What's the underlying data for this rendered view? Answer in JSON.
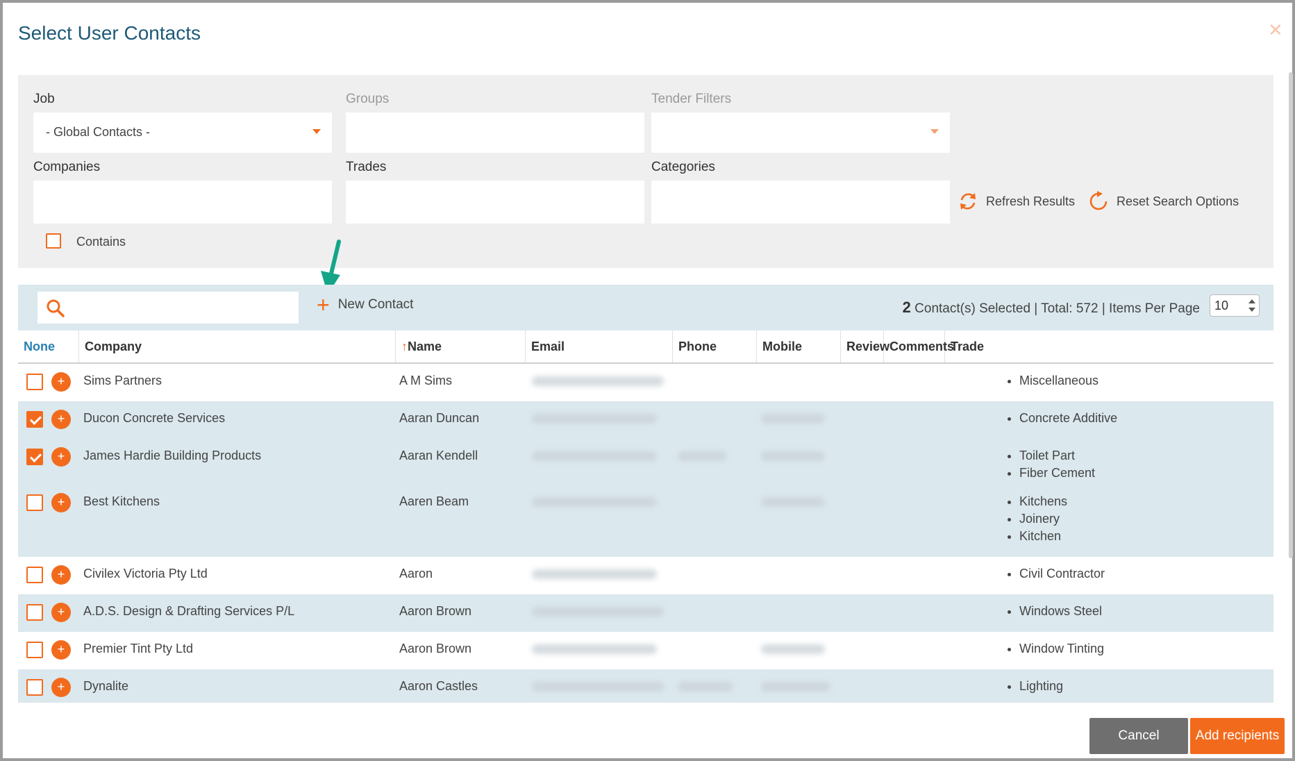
{
  "dialog": {
    "title": "Select User Contacts",
    "close_icon": "close-icon"
  },
  "filters": {
    "job_label": "Job",
    "job_value": "- Global Contacts -",
    "groups_label": "Groups",
    "tender_label": "Tender Filters",
    "companies_label": "Companies",
    "trades_label": "Trades",
    "categories_label": "Categories",
    "refresh_label": "Refresh Results",
    "reset_label": "Reset Search Options",
    "contains_label": "Contains",
    "contains_checked": false
  },
  "toolbar": {
    "search_placeholder": "",
    "new_contact_label": "New Contact",
    "selected_count": "2",
    "selected_text": "Contact(s) Selected | Total: 572 | Items Per Page",
    "items_per_page": "10"
  },
  "table": {
    "headers": {
      "none": "None",
      "company": "Company",
      "name_arrow": "↑",
      "name": "Name",
      "email": "Email",
      "phone": "Phone",
      "mobile": "Mobile",
      "review": "Review",
      "comments": "Comments",
      "trade": "Trade"
    },
    "rows": [
      {
        "company": "Sims Partners",
        "name": "A M Sims",
        "checked": false,
        "trades": [
          "Miscellaneous"
        ]
      },
      {
        "company": "Ducon Concrete Services",
        "name": "Aaran Duncan",
        "checked": true,
        "trades": [
          "Concrete Additive"
        ]
      },
      {
        "company": "James Hardie Building Products",
        "name": "Aaran Kendell",
        "checked": true,
        "trades": [
          "Toilet Part",
          "Fiber Cement"
        ]
      },
      {
        "company": "Best Kitchens",
        "name": "Aaren Beam",
        "checked": false,
        "trades": [
          "Kitchens",
          "Joinery",
          "Kitchen"
        ]
      },
      {
        "company": "Civilex Victoria Pty Ltd",
        "name": "Aaron",
        "checked": false,
        "trades": [
          "Civil Contractor"
        ]
      },
      {
        "company": "A.D.S. Design & Drafting Services P/L",
        "name": "Aaron Brown",
        "checked": false,
        "trades": [
          "Windows Steel"
        ]
      },
      {
        "company": "Premier Tint Pty Ltd",
        "name": "Aaron Brown",
        "checked": false,
        "trades": [
          "Window Tinting"
        ]
      },
      {
        "company": "Dynalite",
        "name": "Aaron Castles",
        "checked": false,
        "trades": [
          "Lighting"
        ]
      }
    ]
  },
  "footer": {
    "cancel_label": "Cancel",
    "add_label": "Add recipients"
  },
  "colors": {
    "accent": "#f26b1d",
    "title": "#1e5a78",
    "row_alt": "#dbe8ee",
    "annotation_arrow": "#14a589"
  }
}
